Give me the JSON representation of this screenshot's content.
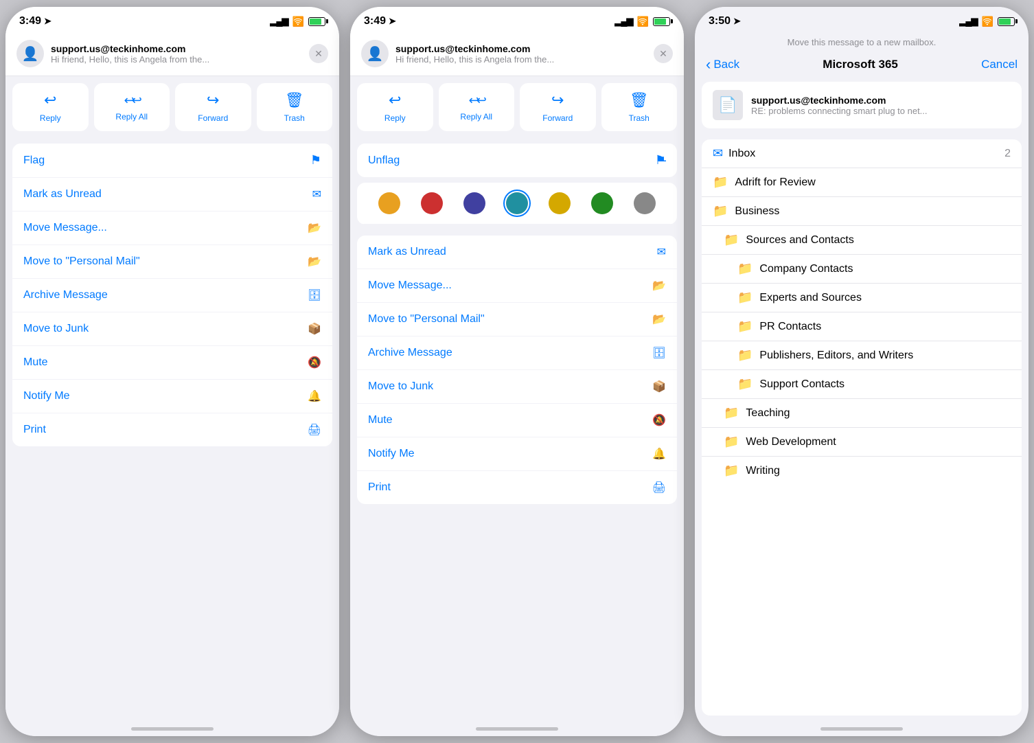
{
  "screen1": {
    "time": "3:49",
    "location_arrow": "➤",
    "email": {
      "from": "support.us@teckinhome.com",
      "preview": "Hi friend,  Hello, this is Angela from the..."
    },
    "action_buttons": [
      {
        "id": "reply",
        "label": "Reply",
        "icon": "↩"
      },
      {
        "id": "reply_all",
        "label": "Reply All",
        "icon": "↩↩"
      },
      {
        "id": "forward",
        "label": "Forward",
        "icon": "↪"
      },
      {
        "id": "trash",
        "label": "Trash",
        "icon": "🗑"
      }
    ],
    "menu_items": [
      {
        "id": "flag",
        "label": "Flag",
        "icon": "⚑"
      },
      {
        "id": "mark_unread",
        "label": "Mark as Unread",
        "icon": "✉"
      },
      {
        "id": "move_message",
        "label": "Move Message...",
        "icon": "📁"
      },
      {
        "id": "move_personal",
        "label": "Move to \"Personal Mail\"",
        "icon": "📁"
      },
      {
        "id": "archive",
        "label": "Archive Message",
        "icon": "🗄"
      },
      {
        "id": "move_junk",
        "label": "Move to Junk",
        "icon": "🗃"
      },
      {
        "id": "mute",
        "label": "Mute",
        "icon": "🔕"
      },
      {
        "id": "notify",
        "label": "Notify Me",
        "icon": "🔔"
      },
      {
        "id": "print",
        "label": "Print",
        "icon": "🖨"
      }
    ]
  },
  "screen2": {
    "time": "3:49",
    "email": {
      "from": "support.us@teckinhome.com",
      "preview": "Hi friend,  Hello, this is Angela from the..."
    },
    "action_buttons": [
      {
        "id": "reply",
        "label": "Reply",
        "icon": "↩"
      },
      {
        "id": "reply_all",
        "label": "Reply All",
        "icon": "↩↩"
      },
      {
        "id": "forward",
        "label": "Forward",
        "icon": "↪"
      },
      {
        "id": "trash",
        "label": "Trash",
        "icon": "🗑"
      }
    ],
    "flag_item": {
      "id": "unflag",
      "label": "Unflag",
      "icon": "⚑"
    },
    "color_dots": [
      {
        "color": "#e8a020",
        "selected": false
      },
      {
        "color": "#cc3030",
        "selected": false
      },
      {
        "color": "#4040a0",
        "selected": false
      },
      {
        "color": "#2090a0",
        "selected": true
      },
      {
        "color": "#d4a800",
        "selected": false
      },
      {
        "color": "#228b22",
        "selected": false
      },
      {
        "color": "#888888",
        "selected": false
      }
    ],
    "menu_items": [
      {
        "id": "mark_unread",
        "label": "Mark as Unread",
        "icon": "✉"
      },
      {
        "id": "move_message",
        "label": "Move Message...",
        "icon": "📁"
      },
      {
        "id": "move_personal",
        "label": "Move to \"Personal Mail\"",
        "icon": "📁"
      },
      {
        "id": "archive",
        "label": "Archive Message",
        "icon": "🗄"
      },
      {
        "id": "move_junk",
        "label": "Move to Junk",
        "icon": "🗃"
      },
      {
        "id": "mute",
        "label": "Mute",
        "icon": "🔕"
      },
      {
        "id": "notify",
        "label": "Notify Me",
        "icon": "🔔"
      },
      {
        "id": "print",
        "label": "Print",
        "icon": "🖨"
      }
    ]
  },
  "screen3": {
    "time": "3:50",
    "hint": "Move this message to a new mailbox.",
    "back_label": "Back",
    "title": "Microsoft 365",
    "cancel_label": "Cancel",
    "email": {
      "from": "support.us@teckinhome.com",
      "subject": "RE: problems connecting smart plug to net..."
    },
    "inbox": {
      "label": "Inbox",
      "count": "2"
    },
    "folders": [
      {
        "label": "Adrift for Review",
        "indent": 0
      },
      {
        "label": "Business",
        "indent": 0
      },
      {
        "label": "Sources and Contacts",
        "indent": 1
      },
      {
        "label": "Company Contacts",
        "indent": 2
      },
      {
        "label": "Experts and Sources",
        "indent": 2
      },
      {
        "label": "PR Contacts",
        "indent": 2
      },
      {
        "label": "Publishers, Editors, and Writers",
        "indent": 2
      },
      {
        "label": "Support Contacts",
        "indent": 2
      },
      {
        "label": "Teaching",
        "indent": 1
      },
      {
        "label": "Web Development",
        "indent": 1
      },
      {
        "label": "Writing",
        "indent": 1
      }
    ]
  },
  "icons": {
    "close": "✕",
    "chevron_left": "‹",
    "person": "👤",
    "mail_doc": "📄"
  }
}
